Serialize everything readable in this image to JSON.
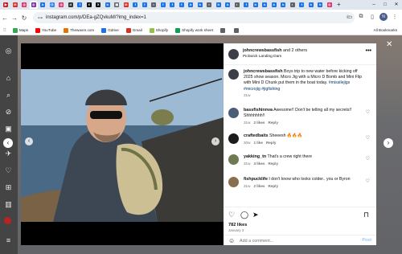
{
  "browser": {
    "tabs": [
      {
        "color": "#c91f1f",
        "glyph": "▶"
      },
      {
        "color": "#d93025",
        "glyph": "M"
      },
      {
        "color": "#e1306c",
        "glyph": "◎"
      },
      {
        "color": "#7a2fb0",
        "glyph": "◎"
      },
      {
        "color": "#1a73e8",
        "glyph": "b"
      },
      {
        "color": "#4285f4",
        "glyph": "G"
      },
      {
        "color": "#e1306c",
        "glyph": "◎"
      },
      {
        "color": "#333333",
        "glyph": "d"
      },
      {
        "color": "#1877f2",
        "glyph": "f"
      },
      {
        "color": "#000000",
        "glyph": "X"
      },
      {
        "color": "#111111",
        "glyph": "X"
      },
      {
        "color": "#1a73e8",
        "glyph": "b"
      },
      {
        "color": "#5f6368",
        "glyph": "▣"
      },
      {
        "color": "#d93025",
        "glyph": "M"
      },
      {
        "color": "#1877f2",
        "glyph": "f"
      },
      {
        "color": "#1877f2",
        "glyph": "f"
      },
      {
        "color": "#5f6368",
        "glyph": "◐"
      },
      {
        "color": "#1877f2",
        "glyph": "f"
      },
      {
        "color": "#1877f2",
        "glyph": "f"
      },
      {
        "color": "#1877f2",
        "glyph": "f"
      },
      {
        "color": "#1a73e8",
        "glyph": "b"
      },
      {
        "color": "#1a73e8",
        "glyph": "b"
      },
      {
        "color": "#5f6368",
        "glyph": "◐"
      },
      {
        "color": "#1a73e8",
        "glyph": "b"
      },
      {
        "color": "#1a73e8",
        "glyph": "b"
      },
      {
        "color": "#5f6368",
        "glyph": "◐"
      },
      {
        "color": "#1877f2",
        "glyph": "f"
      },
      {
        "color": "#1a73e8",
        "glyph": "b"
      },
      {
        "color": "#1a73e8",
        "glyph": "b"
      },
      {
        "color": "#1a73e8",
        "glyph": "b"
      },
      {
        "color": "#1a73e8",
        "glyph": "b"
      },
      {
        "color": "#5f6368",
        "glyph": "◐"
      },
      {
        "color": "#1877f2",
        "glyph": "f"
      },
      {
        "color": "#1a73e8",
        "glyph": "b"
      },
      {
        "color": "#1a73e8",
        "glyph": "b"
      },
      {
        "color": "#e1306c",
        "glyph": "◎"
      }
    ],
    "url": "instagram.com/p/DEa-gZQvkuM/?img_index=1",
    "profile_initial": "N",
    "bookmarks": [
      {
        "label": "Maps",
        "color": "#34a853"
      },
      {
        "label": "YouTube",
        "color": "#ff0000"
      },
      {
        "label": "Thewavre.com",
        "color": "#e37400"
      },
      {
        "label": "Gdrive",
        "color": "#1a73e8"
      },
      {
        "label": "Gmail",
        "color": "#d93025"
      },
      {
        "label": "Shopify",
        "color": "#95bf47"
      },
      {
        "label": "Shopify work sheet",
        "color": "#0f9d58"
      },
      {
        "label": "",
        "color": "#5f6368"
      },
      {
        "label": "",
        "color": "#5f6368"
      }
    ],
    "all_bookmarks": "All Bookmarks"
  },
  "post": {
    "author": "johncrewsbassfish",
    "and_others": "and 2 others",
    "location": "Pickwick Landing Dam",
    "caption": "Boys trip to new water before kicking off 2025 show season. Micro Jig with a Micro D Bomb and Mini Flip with Mini D Chunk put them in the boat today.",
    "caption_tags": "#missilejigs #microjig #jigfishing",
    "caption_time": "31w",
    "likes": "782 likes",
    "date": "January 3",
    "add_comment_placeholder": "Add a comment...",
    "post_label": "Post"
  },
  "comments": [
    {
      "user": "bassfishinnva",
      "text": "Awesome!! Don't be telling all my secrets!! Shhhhhhh!!",
      "time": "31w",
      "likes": "2 likes",
      "reply": "Reply",
      "avatar": "#4c5d77"
    },
    {
      "user": "craftedbaits",
      "text": "Sheeesh 🔥🔥🔥",
      "time": "30w",
      "likes": "1 like",
      "reply": "Reply",
      "avatar": "#1c1c1c"
    },
    {
      "user": "yakking_tn",
      "text": "That's a crew right there",
      "time": "31w",
      "likes": "3 likes",
      "reply": "Reply",
      "avatar": "#6d7a52"
    },
    {
      "user": "fishpucklife",
      "text": "I don't know who looks colder.. you or Byron",
      "time": "31w",
      "likes": "2 likes",
      "reply": "Reply",
      "avatar": "#8a6f4e"
    }
  ]
}
